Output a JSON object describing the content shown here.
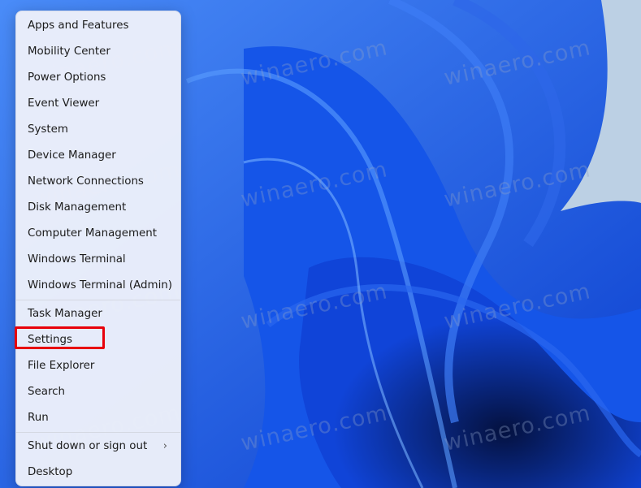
{
  "menu": {
    "groups": [
      [
        "Apps and Features",
        "Mobility Center",
        "Power Options",
        "Event Viewer",
        "System",
        "Device Manager",
        "Network Connections",
        "Disk Management",
        "Computer Management",
        "Windows Terminal",
        "Windows Terminal (Admin)"
      ],
      [
        "Task Manager",
        "Settings",
        "File Explorer",
        "Search",
        "Run"
      ],
      [
        "Shut down or sign out",
        "Desktop"
      ]
    ],
    "submenu_indicator": "›",
    "highlighted_item": "Settings",
    "highlight_color": "#e8000a"
  },
  "watermark": "winaero.com",
  "wallpaper": {
    "accent": "#1a5cf0",
    "dark": "#061a6a",
    "sky": "#bcd0e4"
  }
}
